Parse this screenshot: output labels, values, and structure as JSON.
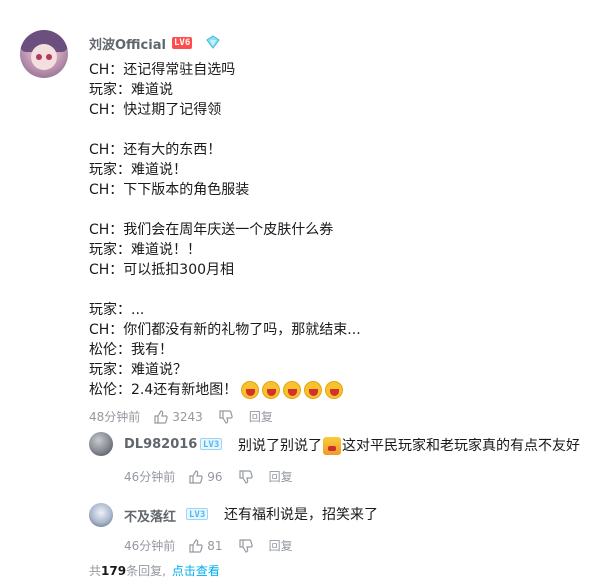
{
  "comment": {
    "username": "刘波Official",
    "level": "LV6",
    "lines": [
      "CH：还记得常驻自选吗",
      "玩家：难道说",
      "CH：快过期了记得领",
      "",
      "CH：还有大的东西！",
      "玩家：难道说！",
      "CH：下下版本的角色服装",
      "",
      "CH：我们会在周年庆送一个皮肤什么券",
      "玩家：难道说！！",
      "CH：可以抵扣300月相",
      "",
      "玩家：...",
      "CH：你们都没有新的礼物了吗，那就结束...",
      "松伦：我有！",
      "玩家：难道说？",
      "松伦：2.4还有新地图！"
    ],
    "time": "48分钟前",
    "likes": "3243",
    "reply_label": "回复"
  },
  "replies": [
    {
      "username": "DL982016",
      "level": "LV3",
      "text_before": "别说了别说了",
      "text_after": "这对平民玩家和老玩家真的有点不友好",
      "time": "46分钟前",
      "likes": "96",
      "reply_label": "回复"
    },
    {
      "username": "不及落红",
      "level": "LV3",
      "text": "还有福利说是，招笑来了",
      "time": "46分钟前",
      "likes": "81",
      "reply_label": "回复"
    }
  ],
  "footer": {
    "prefix": "共",
    "count": "179",
    "suffix": "条回复,",
    "link": "点击查看"
  },
  "colors": {
    "accent": "#00aeec",
    "level6": "#ff4d4d",
    "level3": "#51b8ef",
    "muted": "#9499a0"
  },
  "icons": [
    "diamond-icon",
    "thumb-up-icon",
    "thumb-down-icon",
    "laugh-emoji",
    "angry-emoji"
  ]
}
